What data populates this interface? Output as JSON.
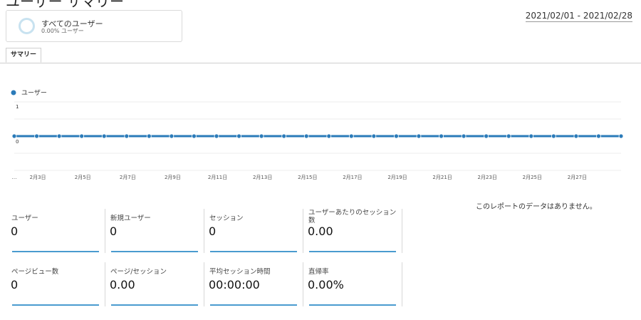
{
  "page": {
    "title": "ユーザー サマリー",
    "date_range": "2021/02/01 - 2021/02/28"
  },
  "segment": {
    "name": "すべてのユーザー",
    "percent": "0.00% ユーザー",
    "percent_value": 0.0
  },
  "tabs": [
    {
      "label": "サマリー",
      "active": true
    }
  ],
  "chart_data": {
    "type": "line",
    "series": [
      {
        "name": "ユーザー",
        "color": "#2b7bb9",
        "values": [
          0,
          0,
          0,
          0,
          0,
          0,
          0,
          0,
          0,
          0,
          0,
          0,
          0,
          0,
          0,
          0,
          0,
          0,
          0,
          0,
          0,
          0,
          0,
          0,
          0,
          0,
          0,
          0
        ]
      }
    ],
    "x_tick_labels": [
      "…",
      "2月3日",
      "2月5日",
      "2月7日",
      "2月9日",
      "2月11日",
      "2月13日",
      "2月15日",
      "2月17日",
      "2月19日",
      "2月21日",
      "2月23日",
      "2月25日",
      "2月27日"
    ],
    "y_tick_labels": [
      "1",
      "0"
    ],
    "ylim": [
      0,
      1
    ],
    "grid": true,
    "legend": "top-left"
  },
  "no_data_message": "このレポートのデータはありません。",
  "metrics": [
    {
      "label": "ユーザー",
      "value": "0"
    },
    {
      "label": "新規ユーザー",
      "value": "0"
    },
    {
      "label": "セッション",
      "value": "0"
    },
    {
      "label": "ユーザーあたりのセッション数",
      "value": "0.00"
    },
    {
      "label": "ページビュー数",
      "value": "0"
    },
    {
      "label": "ページ/セッション",
      "value": "0.00"
    },
    {
      "label": "平均セッション時間",
      "value": "00:00:00"
    },
    {
      "label": "直帰率",
      "value": "0.00%"
    }
  ],
  "colors": {
    "accent": "#2b7bb9",
    "segment_ring": "#c8e2f0"
  }
}
